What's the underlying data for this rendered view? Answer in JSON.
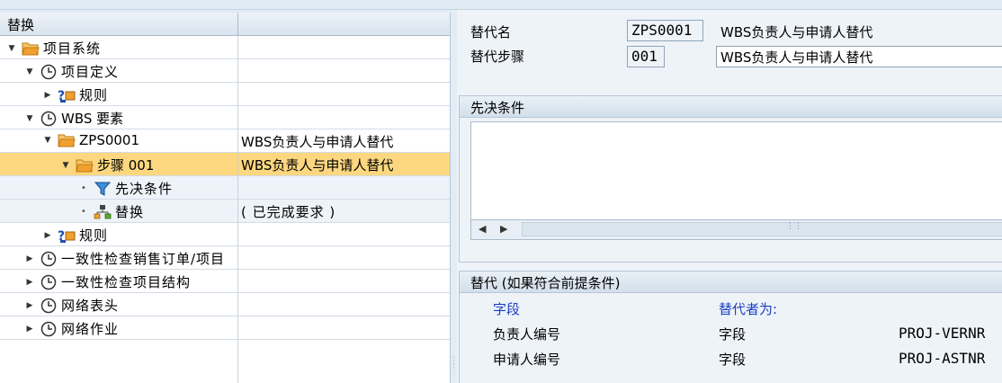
{
  "tree": {
    "column_header": "替换",
    "rows": [
      {
        "label": "项目系统",
        "value": ""
      },
      {
        "label": "项目定义",
        "value": ""
      },
      {
        "label": "规则",
        "value": ""
      },
      {
        "label": "WBS 要素",
        "value": ""
      },
      {
        "label": "ZPS0001",
        "value": "WBS负责人与申请人替代"
      },
      {
        "label": "步骤 001",
        "value": "WBS负责人与申请人替代"
      },
      {
        "label": "先决条件",
        "value": ""
      },
      {
        "label": "替换",
        "value": "( 已完成要求 )"
      },
      {
        "label": "规则",
        "value": ""
      },
      {
        "label": "一致性检查销售订单/项目",
        "value": ""
      },
      {
        "label": "一致性检查项目结构",
        "value": ""
      },
      {
        "label": "网络表头",
        "value": ""
      },
      {
        "label": "网络作业",
        "value": ""
      }
    ]
  },
  "form": {
    "name_label": "替代名",
    "name_value": "ZPS0001",
    "name_desc": "WBS负责人与申请人替代",
    "step_label": "替代步骤",
    "step_value": "001",
    "step_desc": "WBS负责人与申请人替代"
  },
  "prereq": {
    "title": "先决条件"
  },
  "substitution": {
    "title": "替代 (如果符合前提条件)",
    "col_field": "字段",
    "col_by": "替代者为:",
    "rows": [
      {
        "field": "负责人编号",
        "type": "字段",
        "value": "PROJ-VERNR"
      },
      {
        "field": "申请人编号",
        "type": "字段",
        "value": "PROJ-ASTNR"
      }
    ]
  },
  "colors": {
    "selection": "#fcd77f",
    "header_blue": "#1c3fbf",
    "folder": "#f0a030"
  }
}
